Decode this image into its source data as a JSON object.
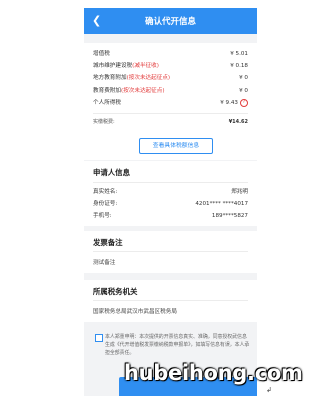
{
  "header": {
    "title": "确认代开信息",
    "back_icon": "chevron-left-icon"
  },
  "taxes": {
    "items": [
      {
        "label": "增值税",
        "note": "",
        "value": "¥ 5.01"
      },
      {
        "label": "城市维护建设税",
        "note": "(减半征收)",
        "value": "¥ 0.18"
      },
      {
        "label": "地方教育附加",
        "note": "(按次未达起征点)",
        "value": "¥ 0"
      },
      {
        "label": "教育费附加",
        "note": "(按次未达起征点)",
        "value": "¥ 0"
      },
      {
        "label": "个人所得税",
        "note": "",
        "value": "¥ 9.43",
        "info": "?"
      }
    ],
    "total": {
      "label": "实缴税费:",
      "value": "¥14.62"
    },
    "detail_button": "查看具体税额信息"
  },
  "applicant": {
    "title": "申请人信息",
    "fields": [
      {
        "label": "真实姓名:",
        "value": "郑兆明"
      },
      {
        "label": "身份证号:",
        "value": "4201**** ****4017"
      },
      {
        "label": "手机号:",
        "value": "189****5827"
      }
    ]
  },
  "remark": {
    "title": "发票备注",
    "text": "测试备注"
  },
  "authority": {
    "title": "所属税务机关",
    "text": "国家税务总局武汉市武昌区税务局"
  },
  "consent": {
    "text": "本人郑重申明：本次提供的开票信息真实、准确，同意授权武信息生成《代开增值税发票缴纳税款申报单》，如填写信息有误，本人承担全部责任。"
  },
  "watermark": "hubeihong.com",
  "colors": {
    "accent": "#2f8ef1",
    "warning": "#e23b3b",
    "background": "#f2f3f5"
  }
}
